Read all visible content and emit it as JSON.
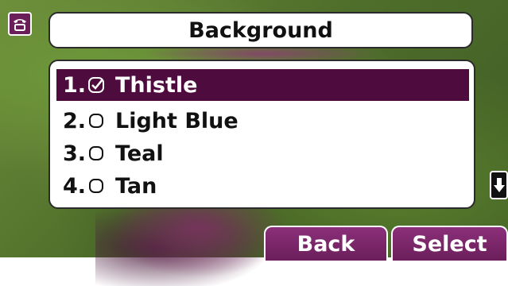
{
  "header": {
    "title": "Background"
  },
  "options": [
    {
      "number": "1.",
      "label": "Thistle",
      "checked": true,
      "selected": true
    },
    {
      "number": "2.",
      "label": "Light Blue",
      "checked": false,
      "selected": false
    },
    {
      "number": "3.",
      "label": "Teal",
      "checked": false,
      "selected": false
    },
    {
      "number": "4.",
      "label": "Tan",
      "checked": false,
      "selected": false
    }
  ],
  "softkeys": {
    "back": "Back",
    "select": "Select"
  },
  "icons": {
    "status": "phone-icon",
    "scroll": "arrow-down-icon",
    "checkbox_checked": "checkbox-checked-icon",
    "checkbox_unchecked": "checkbox-unchecked-icon"
  },
  "colors": {
    "accent": "#6b1f5a",
    "selection": "#4e0b3e"
  }
}
